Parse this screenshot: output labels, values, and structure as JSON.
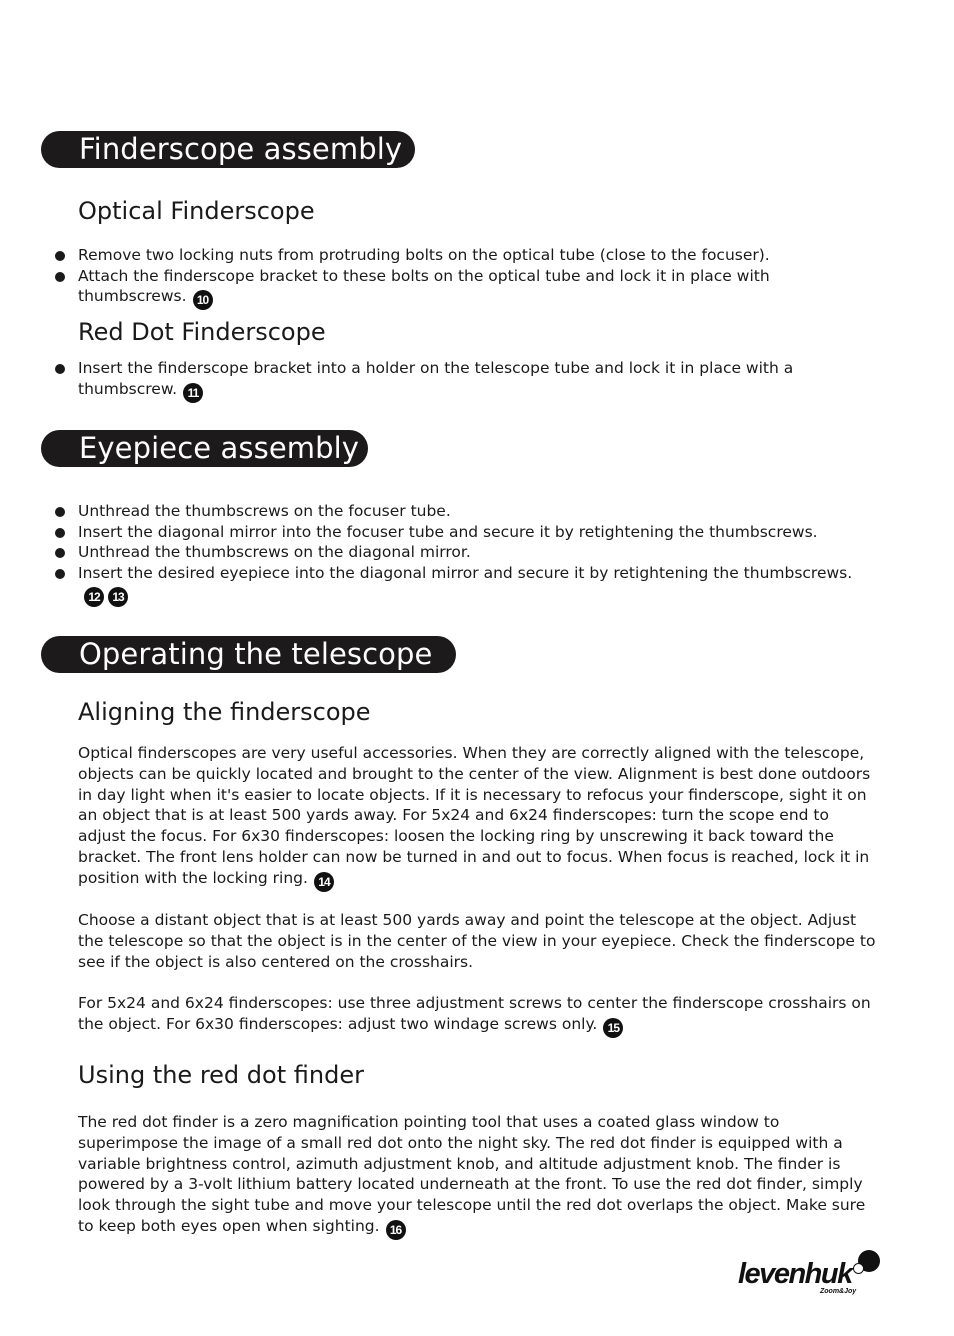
{
  "sections": {
    "finderscope": {
      "title": "Finderscope assembly",
      "optical": {
        "title": "Optical Finderscope",
        "bullets": [
          {
            "text": "Remove two locking nuts from protruding bolts on the optical tube (close to the focuser)."
          },
          {
            "text": "Attach the finderscope bracket to these bolts on the optical tube and lock it in place with thumbscrews.",
            "ref": "10"
          }
        ]
      },
      "reddot": {
        "title": "Red Dot Finderscope",
        "bullets": [
          {
            "text": "Insert the finderscope bracket into a holder on the telescope tube and lock it in place with a thumbscrew.",
            "ref": "11"
          }
        ]
      }
    },
    "eyepiece": {
      "title": "Eyepiece assembly",
      "bullets": [
        {
          "text": "Unthread the thumbscrews on the focuser tube."
        },
        {
          "text": "Insert the diagonal mirror into the focuser tube and secure it by retightening the thumbscrews."
        },
        {
          "text": "Unthread the thumbscrews on the diagonal mirror."
        },
        {
          "text": "Insert the desired eyepiece into the diagonal mirror and secure it by retightening the thumbscrews.",
          "ref": "12",
          "ref2": "13"
        }
      ]
    },
    "operating": {
      "title": "Operating the telescope",
      "aligning": {
        "title": "Aligning the finderscope",
        "paragraphs": [
          {
            "text": "Optical finderscopes are very useful accessories. When they are correctly aligned with the telescope, objects can be quickly located and brought to the center of the view. Alignment is best done outdoors in day light when it's easier to locate objects. If it is necessary to refocus your finderscope, sight it on an object that is at least 500 yards away. For 5x24 and 6x24 finderscopes: turn the scope end to adjust the focus. For 6x30 finderscopes: loosen the locking ring by unscrewing it back toward the bracket. The front lens holder can now be turned in and out to focus. When focus is reached, lock it in position with the locking ring.",
            "ref": "14"
          },
          {
            "text": "Choose a distant object that is at least 500 yards away and point the telescope at the object. Adjust the telescope so that the object is in the center of the view in your eyepiece. Check the finderscope to see if the object is also centered on the crosshairs."
          },
          {
            "text": "For 5x24 and 6x24 finderscopes: use three adjustment screws to center the finderscope crosshairs on the object. For 6x30 finderscopes: adjust two windage screws only.",
            "ref": "15"
          }
        ]
      },
      "reddot": {
        "title": "Using the red dot finder",
        "paragraphs": [
          {
            "text": "The red dot finder is a zero magnification pointing tool that uses a coated glass window to superimpose the image of a small red dot onto the night sky. The red dot finder is equipped with a variable brightness control, azimuth adjustment knob, and altitude adjustment knob. The finder is powered by a 3-volt lithium battery located underneath at the front. To use the red dot finder, simply look through the sight tube and move your telescope until the red dot overlaps the object. Make sure to keep both eyes open when sighting.",
            "ref": "16"
          }
        ]
      }
    }
  },
  "logo": {
    "brand": "levenhuk",
    "tagline": "Zoom&Joy",
    "registered": "®"
  }
}
